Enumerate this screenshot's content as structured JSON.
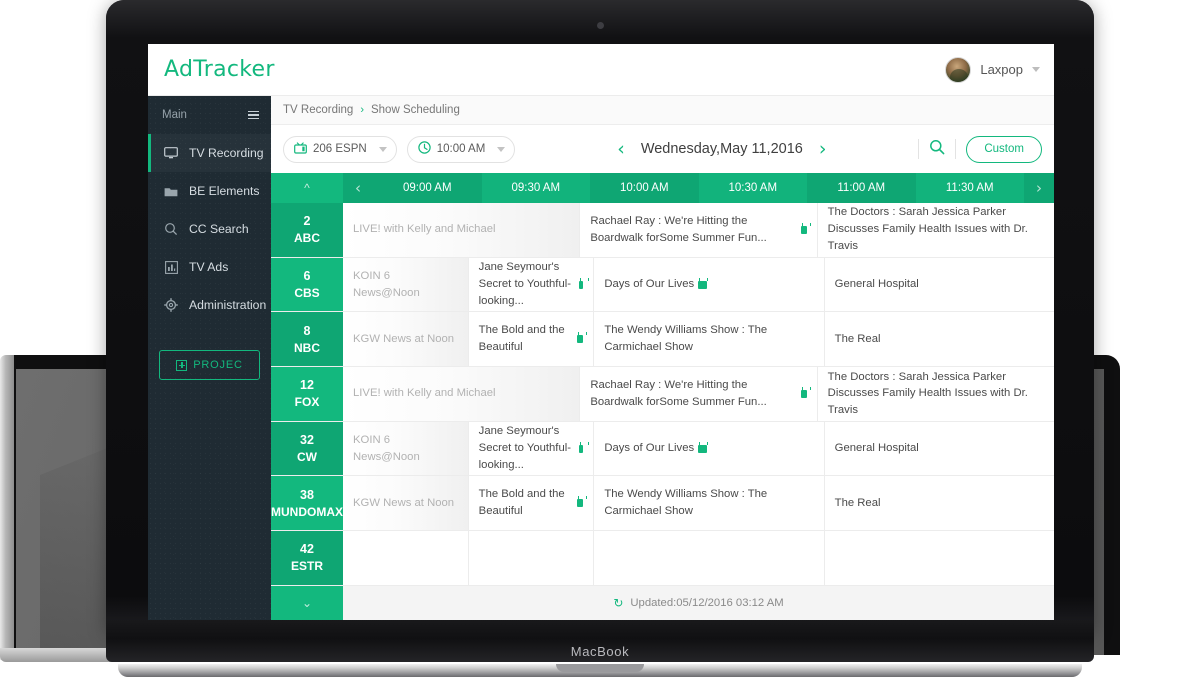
{
  "device": {
    "laptop_label": "MacBook"
  },
  "app": {
    "brand": "AdTracker",
    "user": {
      "name": "Laxpop",
      "avatar_icon": "user-avatar",
      "caret_icon": "chevron-down-icon"
    }
  },
  "sidebar": {
    "section_label": "Main",
    "menu_icon": "hamburger-icon",
    "items": [
      {
        "label": "TV Recording",
        "icon": "monitor-icon",
        "active": true
      },
      {
        "label": "BE Elements",
        "icon": "folder-icon",
        "active": false
      },
      {
        "label": "CC Search",
        "icon": "search-icon",
        "active": false
      },
      {
        "label": "TV Ads",
        "icon": "chart-icon",
        "active": false
      },
      {
        "label": "Administration",
        "icon": "gear-icon",
        "active": false
      }
    ],
    "project_button": {
      "label": "PROJEC",
      "icon": "plus-box-icon"
    }
  },
  "breadcrumb": {
    "items": [
      "TV Recording",
      "Show Scheduling"
    ],
    "separator": "›"
  },
  "toolbar": {
    "channel_filter": {
      "value": "206 ESPN",
      "icon": "tv-icon",
      "caret_icon": "chevron-down-icon"
    },
    "time_filter": {
      "value": "10:00 AM",
      "icon": "clock-icon",
      "caret_icon": "chevron-down-icon"
    },
    "prev_day_icon": "chevron-left-icon",
    "next_day_icon": "chevron-right-icon",
    "date": "Wednesday,May 11,2016",
    "search_icon": "search-icon",
    "custom_button": "Custom"
  },
  "grid": {
    "scroll_up_icon": "chevron-up-icon",
    "scroll_down_icon": "chevron-down-icon",
    "prev_slot_icon": "chevron-left-icon",
    "next_slot_icon": "chevron-right-icon",
    "time_slots": [
      "09:00 AM",
      "09:30 AM",
      "10:00 AM",
      "10:30 AM",
      "11:00 AM",
      "11:30 AM"
    ],
    "rows": [
      {
        "number": "2",
        "network": "ABC",
        "programs": [
          {
            "title": "LIVE! with Kelly and Michael",
            "span": 2,
            "past": true,
            "badge": false
          },
          {
            "title": "Rachael Ray : We're Hitting the Boardwalk forSome Summer Fun...",
            "span": 2,
            "past": false,
            "badge": true
          },
          {
            "title": "The Doctors : Sarah Jessica Parker Discusses Family Health Issues with Dr. Travis",
            "span": 2,
            "past": false,
            "badge": false
          }
        ]
      },
      {
        "number": "6",
        "network": "CBS",
        "programs": [
          {
            "title": "KOIN 6 News@Noon",
            "span": 1,
            "past": true,
            "badge": false
          },
          {
            "title": "Jane Seymour's Secret to Youthful-looking...",
            "span": 1,
            "past": false,
            "badge": true
          },
          {
            "title": "Days of Our Lives",
            "span": 2,
            "past": false,
            "badge": true
          },
          {
            "title": "General Hospital",
            "span": 2,
            "past": false,
            "badge": false
          }
        ]
      },
      {
        "number": "8",
        "network": "NBC",
        "programs": [
          {
            "title": "KGW News at Noon",
            "span": 1,
            "past": true,
            "badge": false
          },
          {
            "title": "The Bold and the Beautiful",
            "span": 1,
            "past": false,
            "badge": true
          },
          {
            "title": "The Wendy Williams Show : The Carmichael Show",
            "span": 2,
            "past": false,
            "badge": false
          },
          {
            "title": "The Real",
            "span": 2,
            "past": false,
            "badge": false
          }
        ]
      },
      {
        "number": "12",
        "network": "FOX",
        "programs": [
          {
            "title": "LIVE! with Kelly and Michael",
            "span": 2,
            "past": true,
            "badge": false
          },
          {
            "title": "Rachael Ray : We're Hitting the Boardwalk forSome Summer Fun...",
            "span": 2,
            "past": false,
            "badge": true
          },
          {
            "title": "The Doctors : Sarah Jessica Parker Discusses Family Health Issues with Dr. Travis",
            "span": 2,
            "past": false,
            "badge": false
          }
        ]
      },
      {
        "number": "32",
        "network": "CW",
        "programs": [
          {
            "title": "KOIN 6 News@Noon",
            "span": 1,
            "past": true,
            "badge": false
          },
          {
            "title": "Jane Seymour's Secret to Youthful-looking...",
            "span": 1,
            "past": false,
            "badge": true
          },
          {
            "title": "Days of Our Lives",
            "span": 2,
            "past": false,
            "badge": true
          },
          {
            "title": "General Hospital",
            "span": 2,
            "past": false,
            "badge": false
          }
        ]
      },
      {
        "number": "38",
        "network": "MUNDOMAX",
        "programs": [
          {
            "title": "KGW News at Noon",
            "span": 1,
            "past": true,
            "badge": false
          },
          {
            "title": "The Bold and the Beautiful",
            "span": 1,
            "past": false,
            "badge": true
          },
          {
            "title": "The Wendy Williams Show : The Carmichael Show",
            "span": 2,
            "past": false,
            "badge": false
          },
          {
            "title": "The Real",
            "span": 2,
            "past": false,
            "badge": false
          }
        ]
      },
      {
        "number": "42",
        "network": "ESTR",
        "programs": [
          {
            "title": "",
            "span": 1,
            "past": false,
            "badge": false
          },
          {
            "title": "",
            "span": 1,
            "past": false,
            "badge": false
          },
          {
            "title": "",
            "span": 2,
            "past": false,
            "badge": false
          },
          {
            "title": "",
            "span": 2,
            "past": false,
            "badge": false
          }
        ]
      }
    ],
    "footer": {
      "refresh_icon": "refresh-icon",
      "status": "Updated:05/12/2016 03:12 AM"
    }
  },
  "colors": {
    "accent": "#13b87e",
    "accent_dark": "#0fa673",
    "sidebar": "#1f2b33"
  }
}
